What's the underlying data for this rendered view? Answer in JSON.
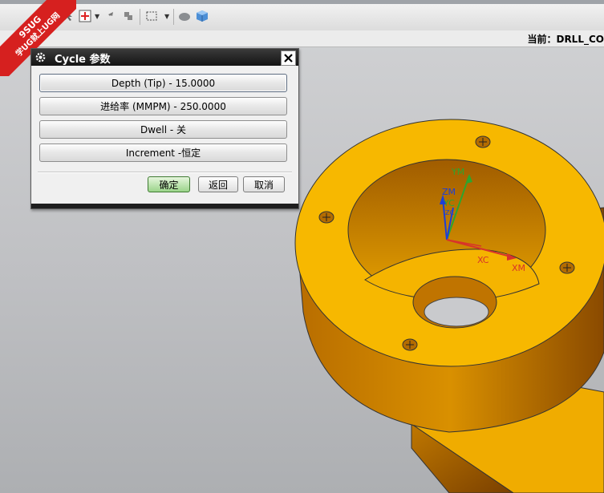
{
  "status": {
    "current_label": "当前：DRLL_CO"
  },
  "badge": {
    "line1": "9SUG",
    "line2": "学UG就上UG网"
  },
  "dialog": {
    "title": "Cycle 参数",
    "options": [
      {
        "label": "Depth (Tip) - 15.0000"
      },
      {
        "label": "进给率 (MMPM) - 250.0000"
      },
      {
        "label": "Dwell - 关"
      },
      {
        "label": "Increment -恒定"
      }
    ],
    "ok_label": "确定",
    "back_label": "返回",
    "cancel_label": "取消"
  },
  "axes": {
    "ym": "YM",
    "zm": "ZM",
    "yc": "YC",
    "xc": "XC",
    "xm": "XM",
    "zc": "ZC"
  },
  "colors": {
    "part_yellow": "#f7b500",
    "title_bar": "#1c1c1c",
    "ok_green": "#9bd48a",
    "badge_red": "#d6201f"
  }
}
